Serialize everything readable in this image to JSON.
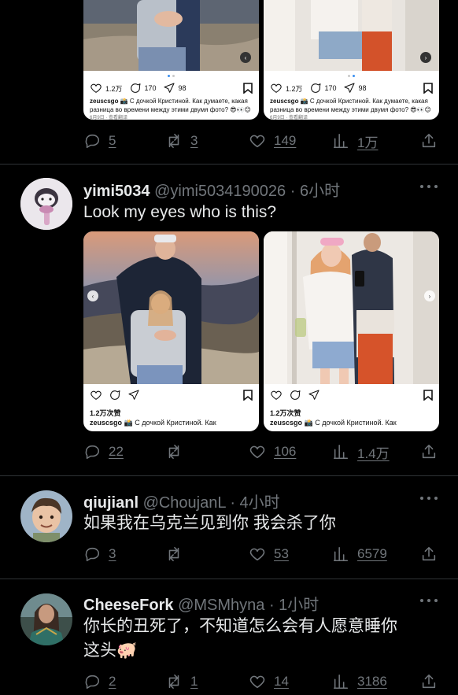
{
  "tweets": [
    {
      "media": [
        {
          "ig_counts": [
            "1.2万",
            "170",
            "98"
          ],
          "caption_user": "zeuscsgo",
          "caption_text": "📸 С дочкой Кристиной. Как думаете, какая разница во времени между этими двумя фото? 😎👀😊",
          "meta": "6月9日 · 查看翻译"
        },
        {
          "ig_counts": [
            "1.2万",
            "170",
            "98"
          ],
          "caption_user": "zeuscsgo",
          "caption_text": "📸 С дочкой Кристиной. Как думаете, какая разница во времени между этими двумя фото? 😎👀😊",
          "meta": "6月9日 · 查看翻译"
        }
      ],
      "actions": {
        "replies": "5",
        "retweets": "3",
        "likes": "149",
        "views": "1万"
      }
    },
    {
      "name": "yimi5034",
      "handle": "@yimi5034190026",
      "time": "· 6小时",
      "text": "Look my eyes who is this?",
      "media": [
        {
          "likes_text": "1.2万次赞",
          "caption_user": "zeuscsgo",
          "caption_text": "📸 С дочкой Кристиной. Как"
        },
        {
          "likes_text": "1.2万次赞",
          "caption_user": "zeuscsgo",
          "caption_text": "📸 С дочкой Кристиной. Как"
        }
      ],
      "actions": {
        "replies": "22",
        "retweets": "",
        "likes": "106",
        "views": "1.4万"
      }
    },
    {
      "name": "qiujianl",
      "handle": "@ChoujanL",
      "time": "· 4小时",
      "text": "如果我在乌克兰见到你 我会杀了你",
      "actions": {
        "replies": "3",
        "retweets": "",
        "likes": "53",
        "views": "6579"
      }
    },
    {
      "name": "CheeseFork",
      "handle": "@MSMhyna",
      "time": "· 1小时",
      "text_line1": "你长的丑死了，不知道怎么会有人愿意睡你",
      "text_line2": "这头🐖",
      "actions": {
        "replies": "2",
        "retweets": "1",
        "likes": "14",
        "views": "3186"
      }
    }
  ],
  "colors": {
    "background": "#000000",
    "text": "#e7e9ea",
    "muted": "#71767b",
    "divider": "#2f3336"
  }
}
